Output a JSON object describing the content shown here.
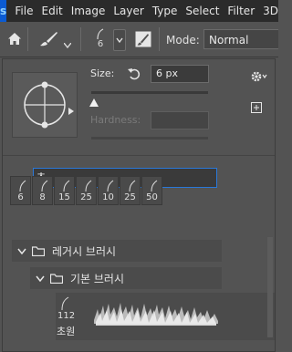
{
  "app": {
    "logo_text": "s"
  },
  "menu": {
    "items": [
      "File",
      "Edit",
      "Image",
      "Layer",
      "Type",
      "Select",
      "Filter",
      "3D"
    ]
  },
  "options": {
    "brush_preset_size": "6",
    "mode_label": "Mode:",
    "mode_value": "Normal"
  },
  "panel": {
    "size_label": "Size:",
    "size_value": "6 px",
    "size_fraction": 0.02,
    "hardness_label": "Hardness:",
    "search_value": "초",
    "recent_sizes": [
      "6",
      "8",
      "15",
      "25",
      "10",
      "25",
      "50"
    ],
    "folders": [
      {
        "label": "레거시 브러시"
      },
      {
        "label": "기본 브러시"
      }
    ],
    "brush": {
      "size": "112",
      "name": "초원"
    }
  },
  "colors": {
    "accent_focus": "#2a78d8",
    "menubar_bg": "#2b2b2b",
    "panel_bg": "#535353"
  }
}
